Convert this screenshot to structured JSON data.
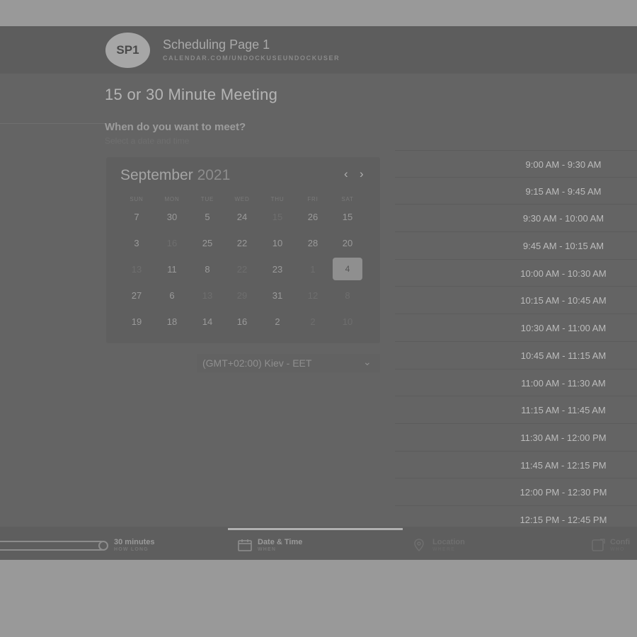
{
  "header": {
    "avatar_initials": "SP1",
    "page_name": "Scheduling Page 1",
    "page_url": "CALENDAR.COM/UNDOCKUSEUNDOCKUSER"
  },
  "meeting": {
    "title": "15 or 30 Minute Meeting",
    "question": "When do you want to meet?",
    "hint": "Select a date and time"
  },
  "calendar": {
    "month": "September",
    "year": "2021",
    "prev_icon": "chevron-left-icon",
    "next_icon": "chevron-right-icon",
    "weekdays": [
      "SUN",
      "MON",
      "TUE",
      "WED",
      "THU",
      "FRI",
      "SAT"
    ],
    "weeks": [
      [
        {
          "d": "7"
        },
        {
          "d": "30"
        },
        {
          "d": "5"
        },
        {
          "d": "24"
        },
        {
          "d": "15",
          "dim": true
        },
        {
          "d": "26"
        },
        {
          "d": "15"
        }
      ],
      [
        {
          "d": "3"
        },
        {
          "d": "16",
          "dim": true
        },
        {
          "d": "25"
        },
        {
          "d": "22"
        },
        {
          "d": "10"
        },
        {
          "d": "28"
        },
        {
          "d": "20"
        }
      ],
      [
        {
          "d": "13",
          "dim": true
        },
        {
          "d": "11"
        },
        {
          "d": "8"
        },
        {
          "d": "22",
          "dim": true
        },
        {
          "d": "23"
        },
        {
          "d": "1",
          "dim": true
        },
        {
          "d": "4",
          "selected": true
        }
      ],
      [
        {
          "d": "27"
        },
        {
          "d": "6"
        },
        {
          "d": "13",
          "dim": true
        },
        {
          "d": "29",
          "dim": true
        },
        {
          "d": "31"
        },
        {
          "d": "12",
          "dim": true
        },
        {
          "d": "8",
          "dim": true
        }
      ],
      [
        {
          "d": "19"
        },
        {
          "d": "18"
        },
        {
          "d": "14"
        },
        {
          "d": "16"
        },
        {
          "d": "2"
        },
        {
          "d": "2",
          "dim": true
        },
        {
          "d": "10",
          "dim": true
        }
      ]
    ]
  },
  "timezone": {
    "label": "(GMT+02:00) Kiev - EET",
    "icon": "chevron-down-icon"
  },
  "time_slots": [
    "9:00 AM - 9:30 AM",
    "9:15 AM - 9:45 AM",
    "9:30 AM - 10:00 AM",
    "9:45 AM - 10:15 AM",
    "10:00 AM - 10:30 AM",
    "10:15 AM - 10:45 AM",
    "10:30 AM - 11:00 AM",
    "10:45 AM - 11:15 AM",
    "11:00 AM - 11:30 AM",
    "11:15 AM - 11:45 AM",
    "11:30 AM - 12:00 PM",
    "11:45 AM - 12:15 PM",
    "12:00 PM - 12:30 PM",
    "12:15 PM - 12:45 PM"
  ],
  "footer": {
    "duration": {
      "title": "30 minutes",
      "sub": "HOW LONG"
    },
    "datetime": {
      "title": "Date & Time",
      "sub": "WHEN",
      "icon": "calendar-icon"
    },
    "location": {
      "title": "Location",
      "sub": "WHERE",
      "icon": "map-pin-icon"
    },
    "confirm": {
      "title": "Confi",
      "sub": "WHO",
      "icon": "confirm-icon"
    }
  }
}
